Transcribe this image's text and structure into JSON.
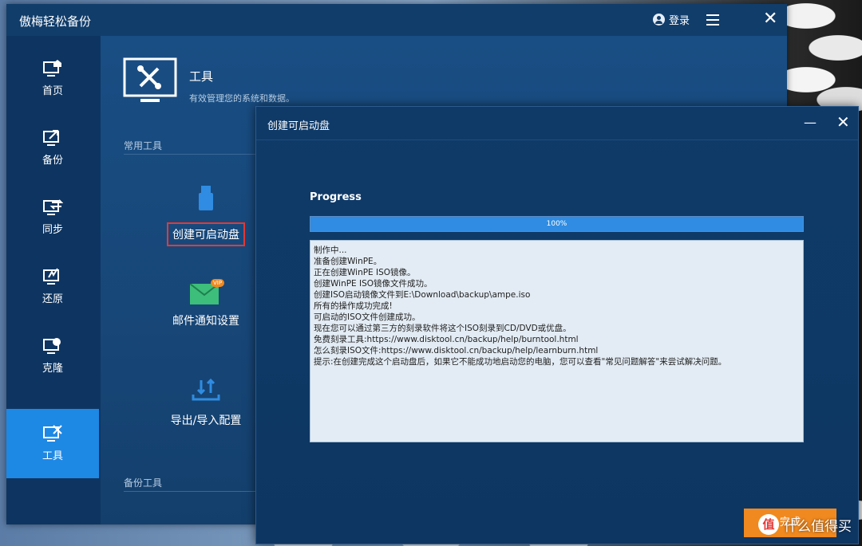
{
  "app": {
    "title": "傲梅轻松备份",
    "login_label": "登录"
  },
  "sidebar": {
    "items": [
      {
        "label": "首页",
        "icon": "home-icon"
      },
      {
        "label": "备份",
        "icon": "backup-icon"
      },
      {
        "label": "同步",
        "icon": "sync-icon"
      },
      {
        "label": "还原",
        "icon": "restore-icon"
      },
      {
        "label": "克隆",
        "icon": "clone-icon"
      },
      {
        "label": "工具",
        "icon": "tools-icon",
        "active": true
      }
    ]
  },
  "content": {
    "title": "工具",
    "subtitle": "有效管理您的系统和数据。",
    "section_common": "常用工具",
    "section_backup": "备份工具",
    "tools": [
      {
        "label": "创建可启动盘",
        "icon": "usb-drive-icon"
      },
      {
        "label": "邮件通知设置",
        "icon": "mail-icon",
        "badge": "VIP"
      },
      {
        "label": "导出/导入配置",
        "icon": "export-import-icon"
      }
    ]
  },
  "dialog": {
    "title": "创建可启动盘",
    "progress_label": "Progress",
    "progress_value": 100,
    "progress_text": "100%",
    "log": [
      "制作中...",
      "准备创建WinPE。",
      "正在创建WinPE ISO镜像。",
      "创建WinPE ISO镜像文件成功。",
      "创建ISO启动镜像文件到E:\\Download\\backup\\ampe.iso",
      "所有的操作成功完成!",
      "可启动的ISO文件创建成功。",
      "现在您可以通过第三方的刻录软件将这个ISO刻录到CD/DVD或优盘。",
      "免费刻录工具:https://www.disktool.cn/backup/help/burntool.html",
      "怎么刻录ISO文件:https://www.disktool.cn/backup/help/learnburn.html",
      "提示:在创建完成这个启动盘后，如果它不能成功地启动您的电脑，您可以查看\"常见问题解答\"来尝试解决问题。"
    ],
    "finish_label": "完成"
  },
  "watermark": {
    "badge": "值",
    "text": "什么值得买"
  },
  "colors": {
    "accent": "#1e88e5",
    "progress": "#2f8ce2",
    "finish": "#f0891f",
    "highlight": "#e53935"
  }
}
